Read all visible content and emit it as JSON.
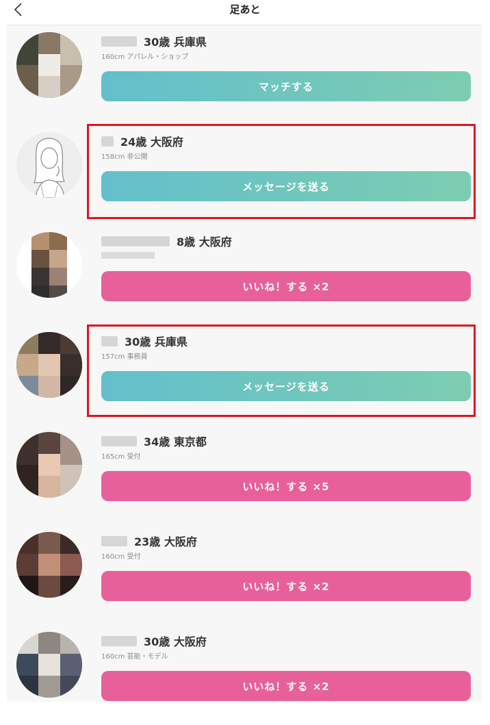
{
  "header": {
    "title": "足あと",
    "back_icon": "chevron-left-icon"
  },
  "colors": {
    "teal_start": "#63bfcc",
    "teal_end": "#7ccdb0",
    "pink": "#e8609a",
    "highlight": "#e0141e"
  },
  "rows": [
    {
      "age_prefecture": "30歳 兵庫県",
      "profile": "160cm アパレル・ショップ",
      "button": "マッチする",
      "button_style": "teal",
      "highlighted": false
    },
    {
      "age_prefecture": "24歳 大阪府",
      "profile": "158cm 非公開",
      "button": "メッセージを送る",
      "button_style": "teal",
      "highlighted": true
    },
    {
      "age_prefecture": "8歳 大阪府",
      "profile": "",
      "button": "いいね！する ×2",
      "button_style": "pink",
      "highlighted": false
    },
    {
      "age_prefecture": "30歳 兵庫県",
      "profile": "157cm 事務員",
      "button": "メッセージを送る",
      "button_style": "teal",
      "highlighted": true
    },
    {
      "age_prefecture": "34歳 東京都",
      "profile": "165cm 受付",
      "button": "いいね！する ×5",
      "button_style": "pink",
      "highlighted": false
    },
    {
      "age_prefecture": "23歳 大阪府",
      "profile": "160cm 受付",
      "button": "いいね！する ×2",
      "button_style": "pink",
      "highlighted": false
    },
    {
      "age_prefecture": "30歳 大阪府",
      "profile": "160cm 芸能・モデル",
      "button": "いいね！する ×2",
      "button_style": "pink",
      "highlighted": false
    }
  ]
}
